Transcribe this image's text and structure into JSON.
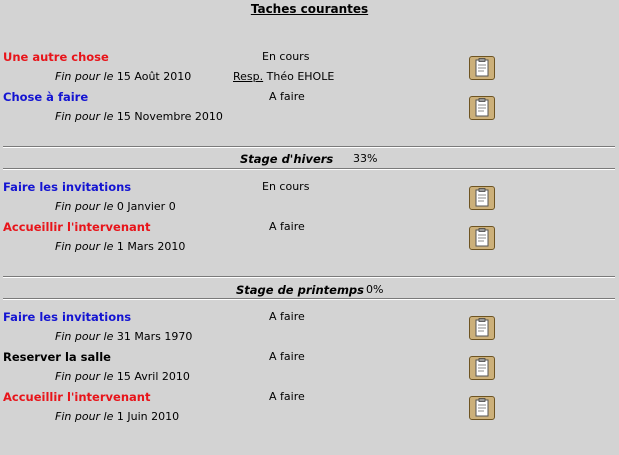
{
  "page_title": "Taches courantes",
  "due_prefix": "Fin pour le",
  "resp_label": "Resp.",
  "icons": {
    "task_button": "clipboard-icon"
  },
  "colors": {
    "red": "#e8141a",
    "blue": "#1414d2",
    "background": "#d3d3d3"
  },
  "current": [
    {
      "title": "Une autre chose",
      "status": "En cours",
      "due": "15 Août 2010",
      "resp": "Théo EHOLE"
    },
    {
      "title": "Chose à faire",
      "status": "A faire",
      "due": "15 Novembre 2010"
    }
  ],
  "sections": [
    {
      "title": "Stage d'hivers",
      "percent": "33%",
      "tasks": [
        {
          "title": "Faire les invitations",
          "status": "En cours",
          "due": "0 Janvier 0"
        },
        {
          "title": "Accueillir l'intervenant",
          "status": "A faire",
          "due": "1 Mars 2010"
        }
      ]
    },
    {
      "title": "Stage de printemps",
      "percent": "0%",
      "tasks": [
        {
          "title": "Faire les invitations",
          "status": "A faire",
          "due": "31 Mars 1970"
        },
        {
          "title": "Reserver la salle",
          "status": "A faire",
          "due": "15 Avril 2010"
        },
        {
          "title": "Accueillir l'intervenant",
          "status": "A faire",
          "due": "1 Juin 2010"
        }
      ]
    }
  ]
}
